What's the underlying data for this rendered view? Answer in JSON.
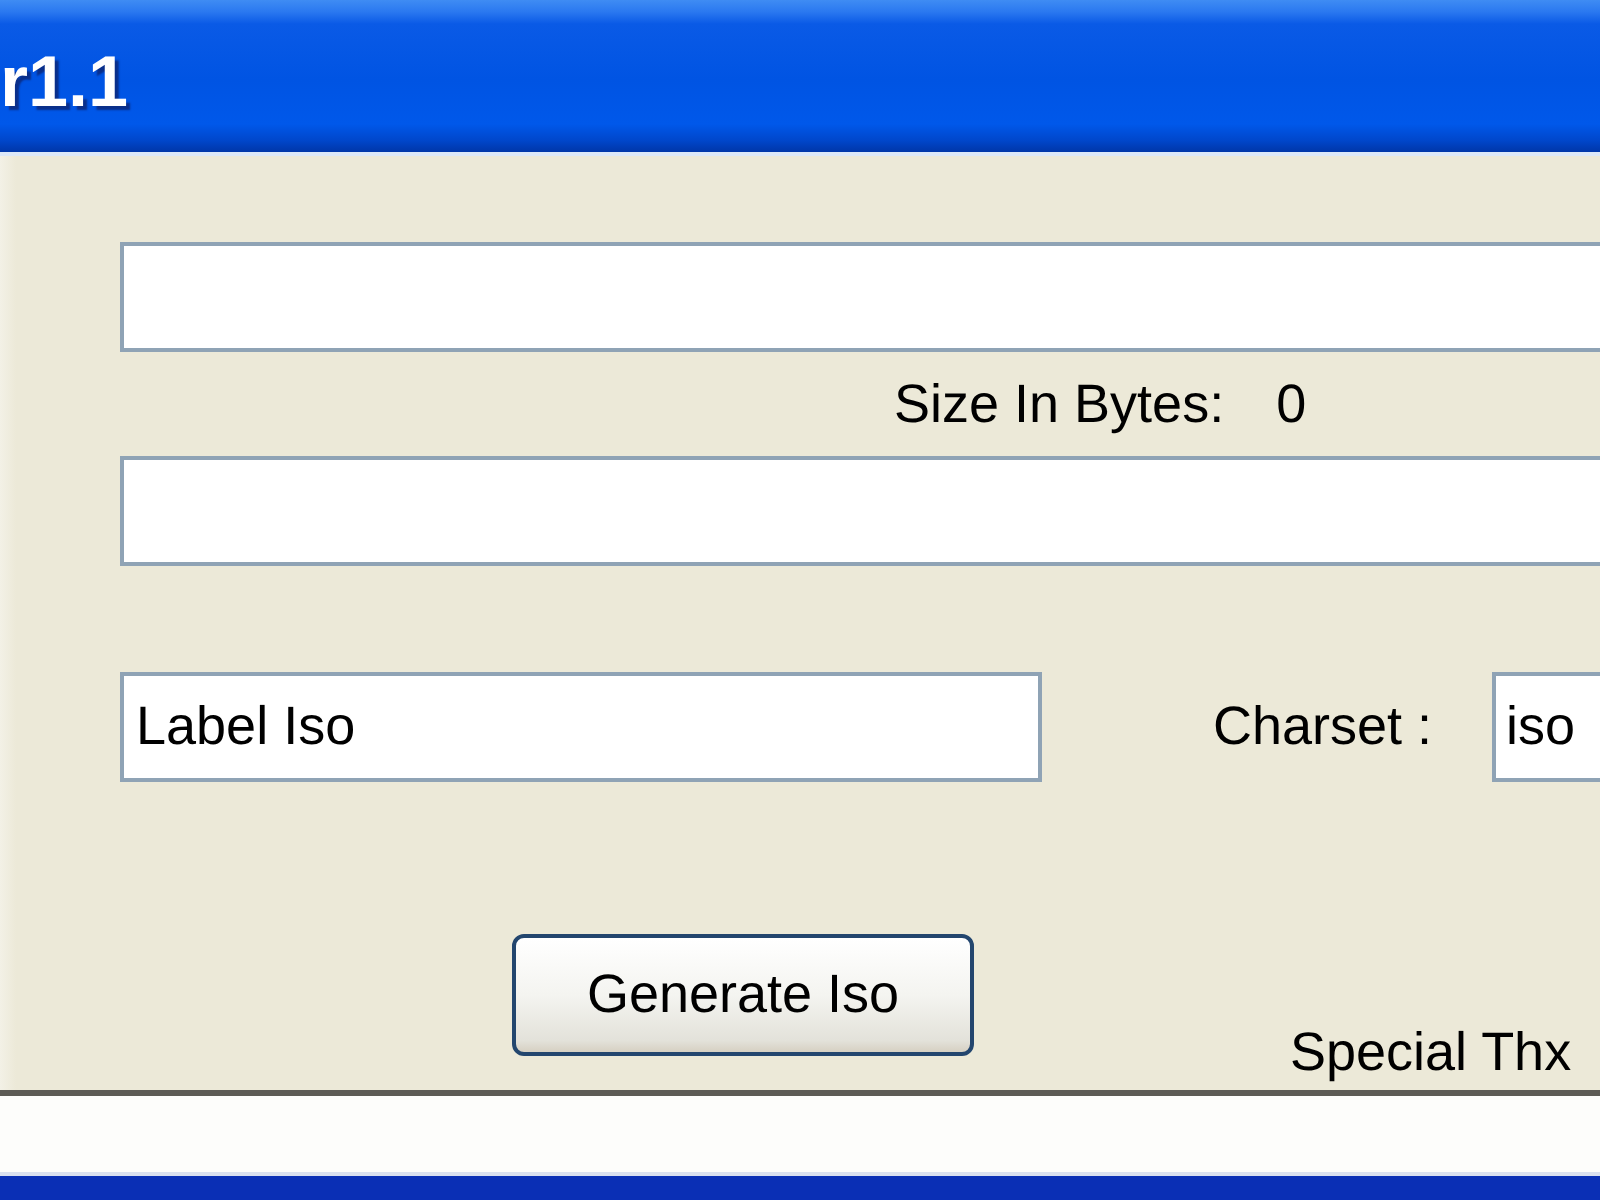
{
  "window": {
    "title": "r1.1"
  },
  "form": {
    "size_label": "Size In Bytes:",
    "size_value": "0",
    "label_field": {
      "value": "Label Iso"
    },
    "charset_label": "Charset :",
    "charset_field": {
      "value": "iso"
    }
  },
  "button": "Generate Iso",
  "credit": "Special Thx"
}
